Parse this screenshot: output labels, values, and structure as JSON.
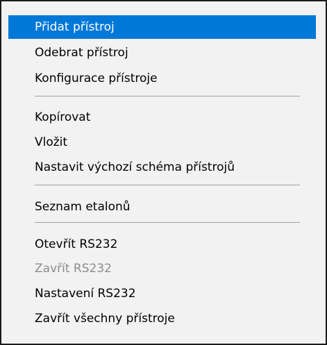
{
  "menu": {
    "items": [
      {
        "label": "Přidat přístroj"
      },
      {
        "label": "Odebrat přístroj"
      },
      {
        "label": "Konfigurace přístroje"
      },
      {
        "label": "Kopírovat"
      },
      {
        "label": "Vložit"
      },
      {
        "label": "Nastavit výchozí schéma přístrojů"
      },
      {
        "label": "Seznam etalonů"
      },
      {
        "label": "Otevřít RS232"
      },
      {
        "label": "Zavřít RS232"
      },
      {
        "label": "Nastavení RS232"
      },
      {
        "label": "Zavřít všechny přístroje"
      }
    ],
    "highlighted_item": "Přidat přístroj",
    "disabled_items": [
      "Zavřít RS232"
    ]
  },
  "colors": {
    "highlight_bg": "#0078d7",
    "highlight_fg": "#ffffff",
    "menu_bg": "#f2f2f2",
    "disabled_fg": "#8c8c8c",
    "separator": "#a0a0a0"
  }
}
